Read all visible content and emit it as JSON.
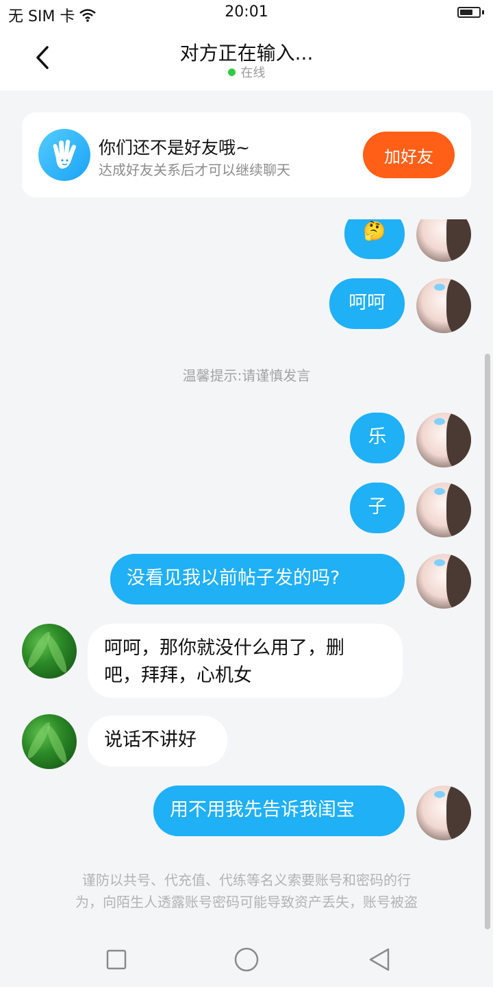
{
  "status_bar": {
    "carrier": "无 SIM 卡",
    "time": "20:01",
    "battery_level": 0.7
  },
  "header": {
    "title": "对方正在输入...",
    "status": "在线",
    "status_color": "#2ecc40",
    "back_icon": "chevron-left-icon"
  },
  "friend_banner": {
    "title": "你们还不是好友哦~",
    "subtitle": "达成好友关系后才可以继续聊天",
    "button_label": "加好友",
    "icon": "hand-icon",
    "button_color": "#ff5f17"
  },
  "messages": [
    {
      "side": "out",
      "text": "🤔"
    },
    {
      "side": "out",
      "text": "呵呵"
    },
    {
      "type": "hint",
      "text": "温馨提示:请谨慎发言"
    },
    {
      "side": "out",
      "text": "乐"
    },
    {
      "side": "out",
      "text": "子"
    },
    {
      "side": "out",
      "text": "没看见我以前帖子发的吗?"
    },
    {
      "side": "in",
      "text_lines": [
        "呵呵，那你就没什么用了，删",
        "吧，拜拜，心机女"
      ]
    },
    {
      "side": "in",
      "text": "说话不讲好"
    },
    {
      "side": "out",
      "text": "用不用我先告诉我闺宝"
    }
  ],
  "warning": {
    "line1": "谨防以共号、代充值、代练等名义索要账号和密码的行",
    "line2": "为，向陌生人透露账号密码可能导致资产丢失，账号被盗"
  },
  "nav": {
    "recent_icon": "square-icon",
    "home_icon": "circle-icon",
    "back_icon": "triangle-back-icon"
  },
  "colors": {
    "outgoing_bubble": "#1fb0f6",
    "incoming_bubble": "#ffffff",
    "background": "#f4f5f7"
  }
}
